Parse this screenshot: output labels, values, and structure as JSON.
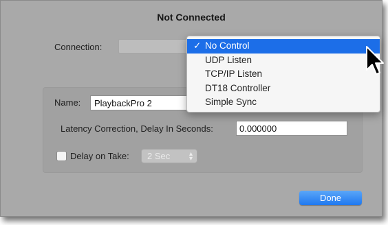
{
  "dialog": {
    "title": "Not Connected",
    "connection_label": "Connection:",
    "connection_menu": {
      "check_mark": "✓",
      "options": [
        "No Control",
        "UDP Listen",
        "TCP/IP Listen",
        "DT18 Controller",
        "Simple Sync"
      ],
      "selected": "No Control"
    },
    "name_label": "Name:",
    "name_value": "PlaybackPro 2",
    "latency_label": "Latency Correction, Delay In Seconds:",
    "latency_value": "0.000000",
    "delay_on_take_label": "Delay on Take:",
    "delay_on_take_value": "2 Sec",
    "delay_on_take_checked": false,
    "done_label": "Done"
  },
  "colors": {
    "window_bg": "#a9a9a9",
    "accent": "#1c6ee8",
    "done_button": "#1f78f0"
  },
  "icons": {
    "cursor": "arrow-cursor-icon",
    "stepper": "up-down-stepper-icon"
  }
}
